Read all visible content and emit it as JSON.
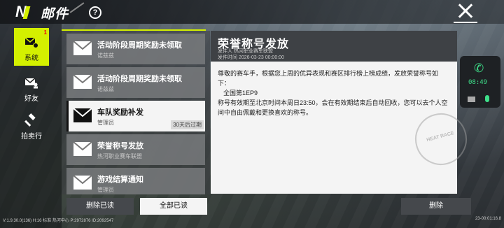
{
  "header": {
    "title": "邮件",
    "help_icon": "help-circle-icon"
  },
  "nav": [
    {
      "label": "系统",
      "icon": "mail-gear-icon",
      "badge": "1",
      "active": true
    },
    {
      "label": "好友",
      "icon": "mail-person-icon"
    },
    {
      "label": "拍卖行",
      "icon": "gavel-icon"
    }
  ],
  "mails": [
    {
      "subject": "活动阶段周期奖励未领取",
      "sender": "诺兹兹"
    },
    {
      "subject": "活动阶段周期奖励未领取",
      "sender": "诺兹兹"
    },
    {
      "subject": "车队奖励补发",
      "sender": "管理员",
      "expiry": "30天后过期",
      "active": true
    },
    {
      "subject": "荣誉称号发放",
      "sender": "热河职业赛车联盟"
    },
    {
      "subject": "游戏结算通知",
      "sender": "管理员"
    }
  ],
  "mail_detail": {
    "title": "荣誉称号发放",
    "sender_line": "发件人 热河职业赛车联盟",
    "time_line": "发件时间 2026-03-23 00:00:00",
    "body": [
      "尊敬的赛车手，根据您上周的优异表现和赛区排行榜上榜成绩，发放荣誉称号如下：",
      "全国第1EP9",
      "称号有效期至北京时间本周日23:50，会在有效期结束后自动回收，您可以去个人空间中自由佩戴和更换喜欢的称号。"
    ]
  },
  "call_widget": {
    "time": "08:49"
  },
  "actions": {
    "delete_read": "删除已读",
    "read_all": "全部已读",
    "delete": "删除"
  },
  "footer": {
    "left": "V:1.9.30.0(136) H:16 标准 热河中心 P:2972876 ID:2092547",
    "right": "23-00:01:16.8"
  },
  "colors": {
    "accent": "#d4f000",
    "call_green": "#3ee08a"
  }
}
